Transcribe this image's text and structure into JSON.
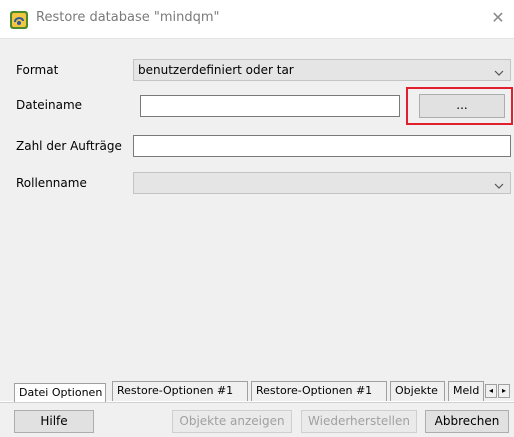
{
  "window": {
    "title": "Restore database \"mindqm\"",
    "close_glyph": "✕"
  },
  "form": {
    "format_label": "Format",
    "format_value": "benutzerdefiniert oder tar",
    "filename_label": "Dateiname",
    "filename_value": "",
    "browse_label": "...",
    "jobs_label": "Zahl der Aufträge",
    "jobs_value": "",
    "role_label": "Rollenname",
    "role_value": ""
  },
  "tabs": [
    {
      "label": "Datei Optionen",
      "active": true
    },
    {
      "label": "Restore-Optionen #1",
      "active": false
    },
    {
      "label": "Restore-Optionen #1",
      "active": false
    },
    {
      "label": "Objekte",
      "active": false
    },
    {
      "label": "Meld",
      "active": false
    }
  ],
  "buttons": {
    "help": "Hilfe",
    "show_objects": "Objekte anzeigen",
    "restore": "Wiederherstellen",
    "cancel": "Abbrechen"
  },
  "icons": {
    "app": "pgadmin-restore-icon",
    "dropdown": "chevron-down-icon",
    "tab_left": "arrow-left-icon",
    "tab_right": "arrow-right-icon"
  },
  "colors": {
    "highlight": "#e0202c",
    "disabled_text": "#a0a0a0"
  }
}
